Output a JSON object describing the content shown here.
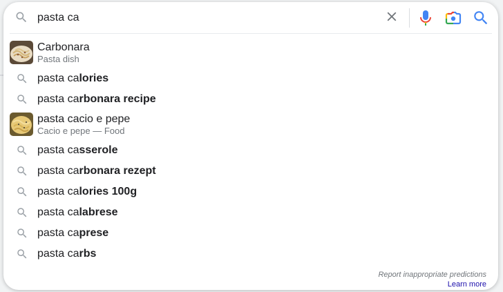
{
  "search": {
    "query": "pasta ca"
  },
  "colors": {
    "icon_gray": "#9aa0a6",
    "clear_gray": "#70757a",
    "blue": "#4285f4",
    "red": "#ea4335",
    "yellow": "#fbbc04",
    "green": "#34a853",
    "link": "#1a0dab"
  },
  "suggestions": [
    {
      "type": "rich",
      "icon": "carbonara-thumbnail",
      "title": "Carbonara",
      "subtitle": "Pasta dish"
    },
    {
      "type": "simple",
      "icon": "search-icon",
      "prefix": "pasta ca",
      "completion": "lories"
    },
    {
      "type": "simple",
      "icon": "search-icon",
      "prefix": "pasta ca",
      "completion": "rbonara recipe"
    },
    {
      "type": "rich",
      "icon": "cacio-e-pepe-thumbnail",
      "title": "pasta cacio e pepe",
      "subtitle": "Cacio e pepe — Food"
    },
    {
      "type": "simple",
      "icon": "search-icon",
      "prefix": "pasta ca",
      "completion": "sserole"
    },
    {
      "type": "simple",
      "icon": "search-icon",
      "prefix": "pasta ca",
      "completion": "rbonara rezept"
    },
    {
      "type": "simple",
      "icon": "search-icon",
      "prefix": "pasta ca",
      "completion": "lories 100g"
    },
    {
      "type": "simple",
      "icon": "search-icon",
      "prefix": "pasta ca",
      "completion": "labrese"
    },
    {
      "type": "simple",
      "icon": "search-icon",
      "prefix": "pasta ca",
      "completion": "prese"
    },
    {
      "type": "simple",
      "icon": "search-icon",
      "prefix": "pasta ca",
      "completion": "rbs"
    }
  ],
  "footer": {
    "report": "Report inappropriate predictions",
    "learn_more": "Learn more"
  }
}
